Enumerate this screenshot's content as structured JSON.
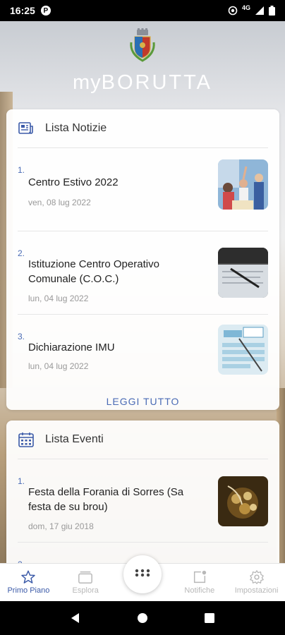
{
  "status_bar": {
    "time": "16:25",
    "app_badge": "P",
    "network": "4G"
  },
  "brand": {
    "prefix": "my",
    "name": "BORUTTA"
  },
  "news_card": {
    "title": "Lista Notizie",
    "items": [
      {
        "num": "1.",
        "title": "Centro Estivo 2022",
        "date": "ven, 08 lug 2022"
      },
      {
        "num": "2.",
        "title": "Istituzione Centro Operativo Comunale (C.O.C.)",
        "date": "lun, 04 lug 2022"
      },
      {
        "num": "3.",
        "title": "Dichiarazione IMU",
        "date": "lun, 04 lug 2022"
      }
    ],
    "read_all": "LEGGI TUTTO"
  },
  "events_card": {
    "title": "Lista Eventi",
    "items": [
      {
        "num": "1.",
        "title": "Festa della Forania di Sorres (Sa festa de su brou)",
        "date": "dom, 17 giu 2018"
      },
      {
        "num": "2.",
        "title": "",
        "date": ""
      }
    ]
  },
  "bottom_nav": {
    "items": [
      {
        "label": "Primo Piano",
        "icon": "star-icon",
        "active": true
      },
      {
        "label": "Esplora",
        "icon": "folder-icon"
      },
      {
        "label": "Notifiche",
        "icon": "notification-icon"
      },
      {
        "label": "Impostazioni",
        "icon": "gear-icon"
      }
    ],
    "center_icon": "grid-icon"
  },
  "colors": {
    "accent": "#3b5aa8",
    "link": "#4a6bb5",
    "inactive": "#b8b8b8"
  }
}
